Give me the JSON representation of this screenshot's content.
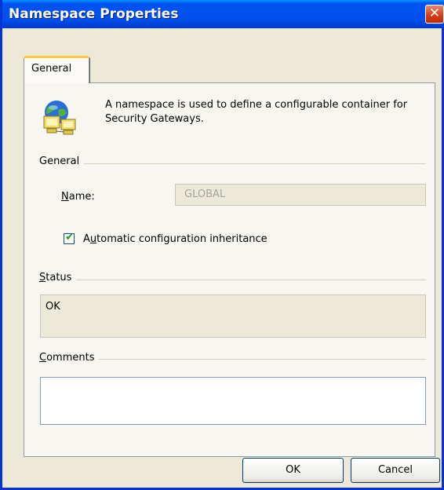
{
  "window": {
    "title": "Namespace Properties",
    "close_glyph": "✕"
  },
  "tabs": [
    {
      "label": "General",
      "active": true
    }
  ],
  "header": {
    "icon": "namespace-globe-computers-icon",
    "description": "A namespace is used to define a configurable container for Security Gateways."
  },
  "general_group": {
    "label": "General",
    "name_label": "Name:",
    "name_value": "GLOBAL",
    "auto_inherit_label": "Automatic configuration inheritance",
    "auto_inherit_checked": true
  },
  "status_group": {
    "label": "Status",
    "value": "OK"
  },
  "comments_group": {
    "label": "Comments",
    "value": ""
  },
  "buttons": {
    "ok": "OK",
    "cancel": "Cancel"
  },
  "colors": {
    "titlebar": "#0053ee",
    "face": "#ece9d8",
    "close": "#d23c14"
  }
}
